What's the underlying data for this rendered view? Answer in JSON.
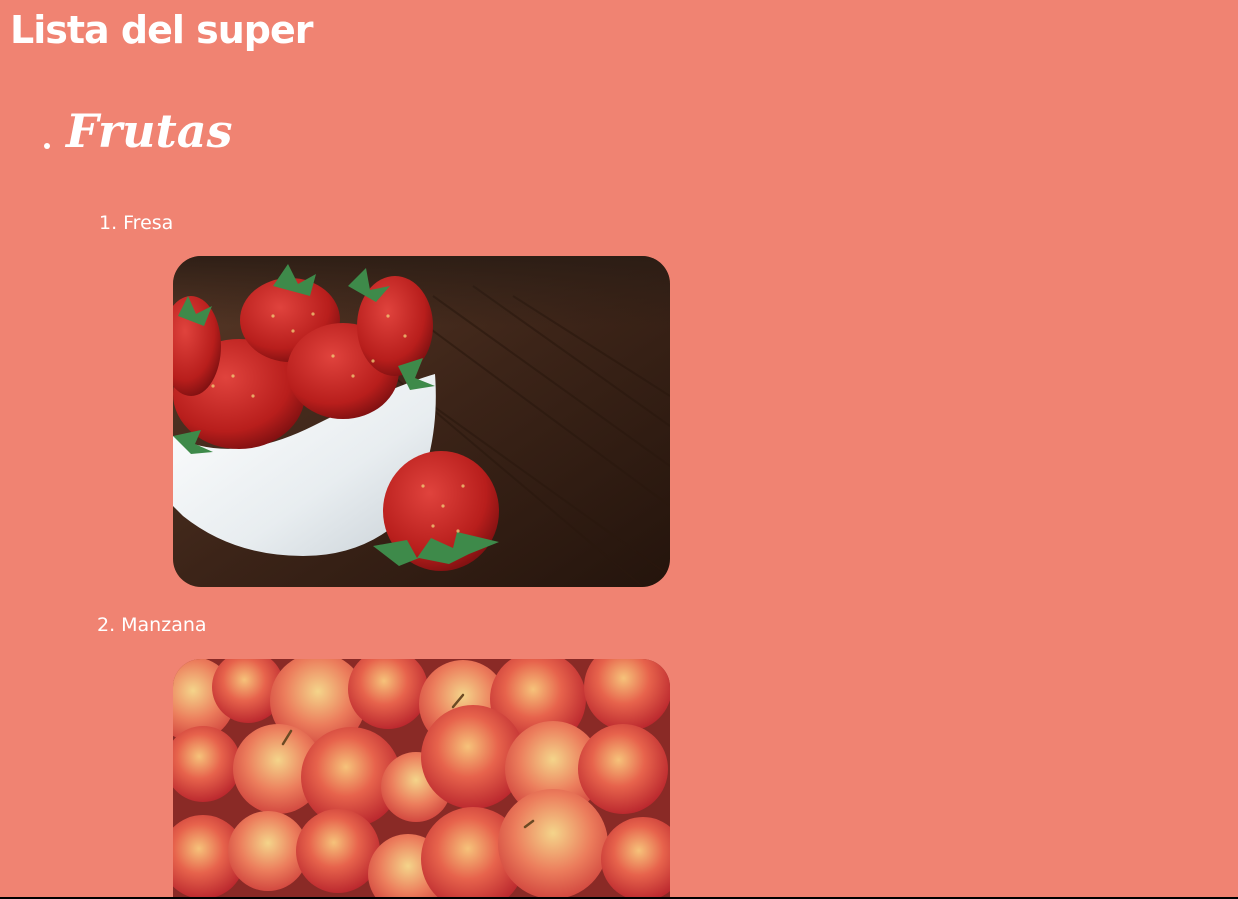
{
  "page": {
    "title": "Lista del super",
    "background": "#f08372",
    "text_color": "#ffffff"
  },
  "section": {
    "heading": "Frutas",
    "items": [
      {
        "number": "1.",
        "label": "Fresa",
        "image": "strawberries-in-white-bowl"
      },
      {
        "number": "2.",
        "label": "Manzana",
        "image": "pile-of-red-apples"
      }
    ]
  }
}
